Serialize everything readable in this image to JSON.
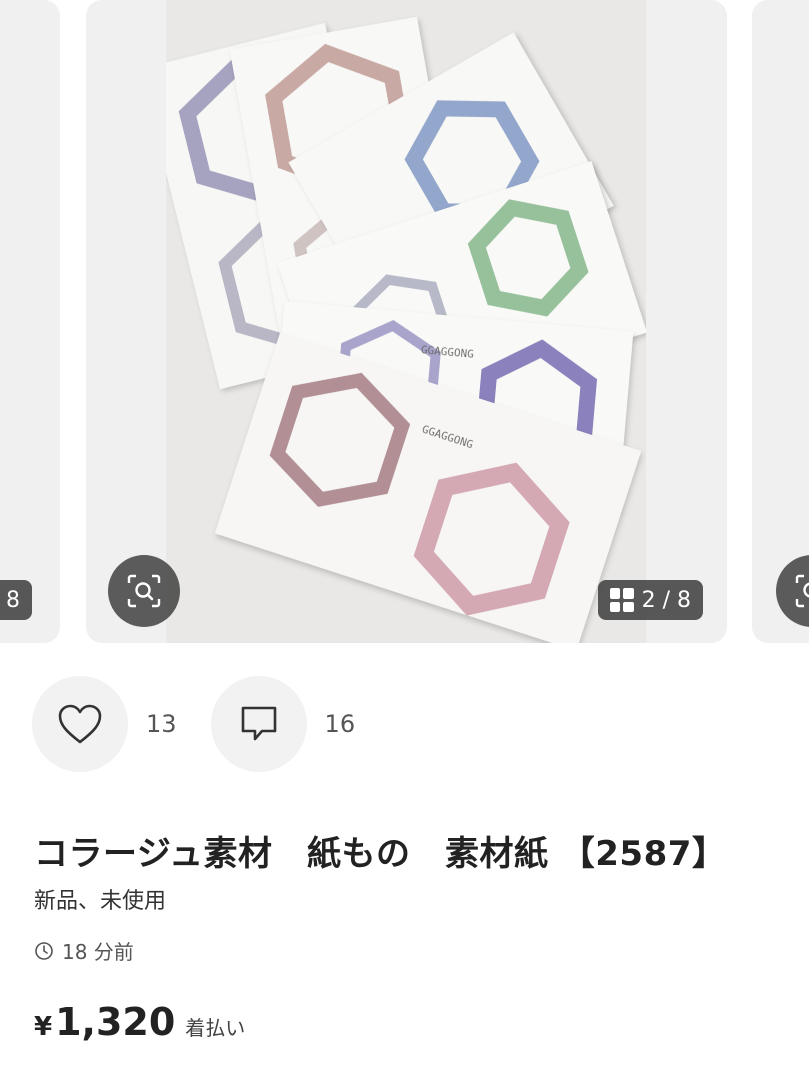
{
  "carousel": {
    "left_counter": "/ 8",
    "main_counter": "2 / 8",
    "photo_text": "GGAGGONG"
  },
  "actions": {
    "like_count": "13",
    "comment_count": "16"
  },
  "item": {
    "title": "コラージュ素材　紙もの　素材紙 【2587】",
    "condition": "新品、未使用",
    "posted": "18 分前",
    "currency": "¥",
    "price": "1,320",
    "shipping": "着払い"
  },
  "colors": {
    "card_bg": "#f0f0f0",
    "overlay": "#464646",
    "text": "#222222"
  }
}
